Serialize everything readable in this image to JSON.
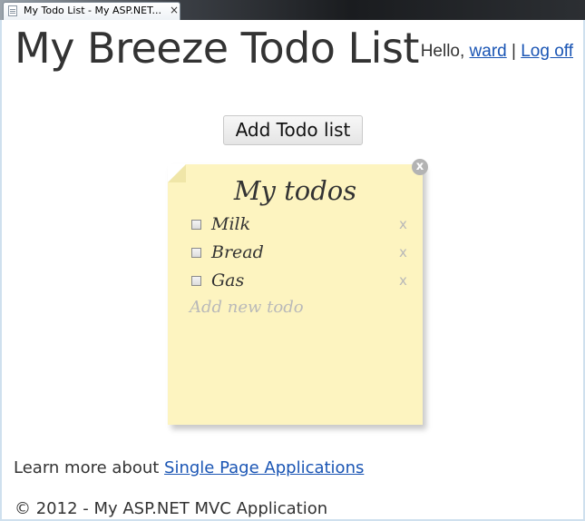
{
  "browser": {
    "tab_title": "My Todo List - My ASP.NET...",
    "tab_close": "×"
  },
  "header": {
    "site_title": "My Breeze Todo List",
    "greeting": "Hello, ",
    "username": "ward",
    "separator": " | ",
    "logoff_label": "Log off"
  },
  "toolbar": {
    "add_list_label": "Add Todo list"
  },
  "todo_list": {
    "close_label": "x",
    "title": "My todos",
    "items": [
      {
        "text": "Milk",
        "done": false,
        "delete_label": "x"
      },
      {
        "text": "Bread",
        "done": false,
        "delete_label": "x"
      },
      {
        "text": "Gas",
        "done": false,
        "delete_label": "x"
      }
    ],
    "add_placeholder": "Add new todo"
  },
  "info": {
    "learn_prefix": "Learn more about ",
    "learn_link": "Single Page Applications"
  },
  "footer": {
    "text": "© 2012 - My ASP.NET MVC Application"
  },
  "colors": {
    "note_background": "#fdf4c0",
    "link": "#1a55b4",
    "text": "#333333"
  }
}
